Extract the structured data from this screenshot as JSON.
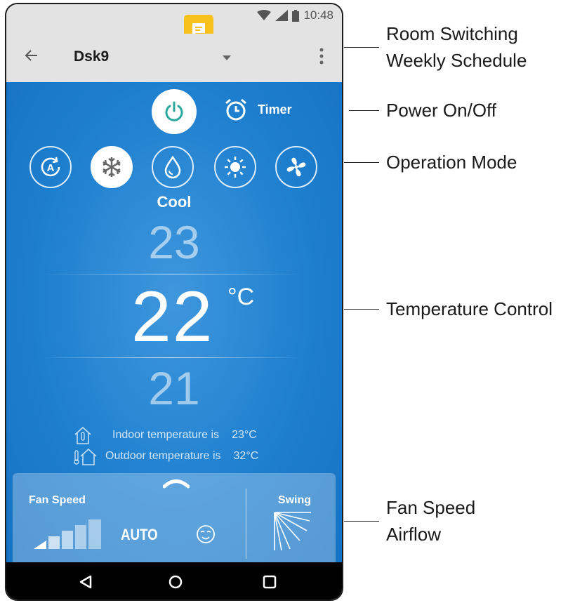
{
  "status_bar": {
    "time": "10:48"
  },
  "app_bar": {
    "room_name": "Dsk9"
  },
  "power": {
    "state": "on"
  },
  "timer": {
    "label": "Timer"
  },
  "modes": [
    {
      "name": "auto",
      "active": false
    },
    {
      "name": "cool",
      "active": true
    },
    {
      "name": "dry",
      "active": false
    },
    {
      "name": "heat",
      "active": false
    },
    {
      "name": "fan",
      "active": false
    }
  ],
  "current_mode_label": "Cool",
  "temperature": {
    "upper": "23",
    "setpoint": "22",
    "unit": "°C",
    "lower": "21"
  },
  "indoor": {
    "label": "Indoor temperature is",
    "value": "23°C"
  },
  "outdoor": {
    "label": "Outdoor temperature is",
    "value": "32°C"
  },
  "fan_panel": {
    "fan_speed_label": "Fan Speed",
    "fan_speed_value": "AUTO",
    "swing_label": "Swing"
  },
  "callouts": [
    {
      "line1": "Room Switching",
      "line2": "Weekly Schedule"
    },
    {
      "line1": "Power On/Off"
    },
    {
      "line1": "Operation Mode"
    },
    {
      "line1": "Temperature Control"
    },
    {
      "line1": "Fan Speed",
      "line2": "Airflow"
    }
  ],
  "colors": {
    "background_blue": "#1f80cf",
    "notification_yellow": "#f7c21c",
    "power_icon_teal": "#2aa79b"
  }
}
